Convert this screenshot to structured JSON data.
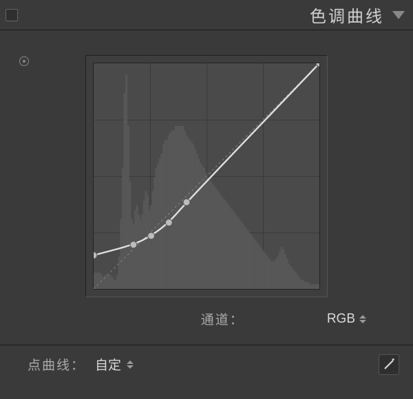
{
  "header": {
    "title": "色调曲线"
  },
  "channel": {
    "label": "通道：",
    "value": "RGB"
  },
  "point_curve": {
    "label": "点曲线：",
    "value": "自定"
  },
  "icons": {
    "collapse": "collapse-triangle-icon",
    "target": "target-adjust-icon",
    "stepper": "stepper-icon",
    "edit": "pencil-icon"
  },
  "chart_data": {
    "type": "line",
    "title": "",
    "xlabel": "",
    "ylabel": "",
    "xlim": [
      0,
      255
    ],
    "ylim": [
      0,
      255
    ],
    "grid": true,
    "grid_divisions": 4,
    "series": [
      {
        "name": "tone-curve",
        "points": [
          {
            "x": 0,
            "y": 38
          },
          {
            "x": 45,
            "y": 50
          },
          {
            "x": 65,
            "y": 60
          },
          {
            "x": 85,
            "y": 75
          },
          {
            "x": 105,
            "y": 98
          },
          {
            "x": 255,
            "y": 255
          }
        ]
      }
    ],
    "reference_line": [
      {
        "x": 0,
        "y": 0
      },
      {
        "x": 255,
        "y": 255
      }
    ],
    "histogram": [
      7,
      7,
      7,
      7,
      6,
      5,
      6,
      6,
      6,
      6,
      5,
      4,
      4,
      6,
      14,
      30,
      52,
      84,
      92,
      70,
      46,
      30,
      28,
      34,
      36,
      32,
      30,
      32,
      38,
      42,
      40,
      34,
      36,
      42,
      48,
      52,
      54,
      56,
      58,
      62,
      64,
      64,
      66,
      67,
      68,
      68,
      70,
      70,
      70,
      70,
      70,
      68,
      66,
      65,
      64,
      63,
      62,
      60,
      58,
      56,
      54,
      53,
      52,
      50,
      48,
      47,
      46,
      45,
      44,
      43,
      42,
      41,
      40,
      39,
      38,
      37,
      36,
      35,
      34,
      33,
      32,
      31,
      30,
      29,
      28,
      27,
      26,
      25,
      24,
      23,
      22,
      21,
      20,
      19,
      18,
      17,
      16,
      15,
      14,
      13,
      12,
      12,
      12,
      13,
      14,
      16,
      18,
      17,
      15,
      13,
      11,
      10,
      9,
      8,
      7,
      6,
      5,
      4,
      4,
      3,
      3,
      3,
      2,
      2,
      2,
      2,
      2,
      2
    ]
  }
}
